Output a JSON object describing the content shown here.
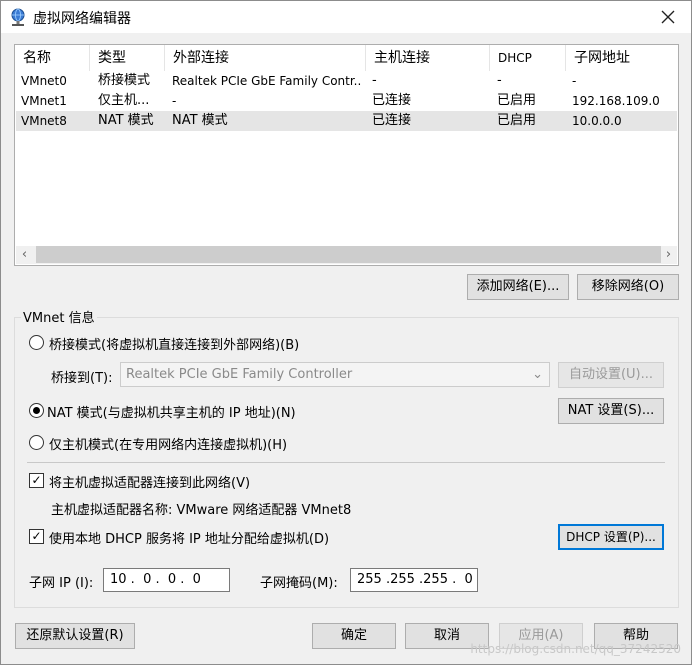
{
  "window": {
    "title": "虚拟网络编辑器"
  },
  "columns": [
    "名称",
    "类型",
    "外部连接",
    "主机连接",
    "DHCP",
    "子网地址"
  ],
  "networks": [
    [
      "VMnet0",
      "桥接模式",
      "Realtek PCIe GbE Family Contr...",
      "-",
      "-",
      "-"
    ],
    [
      "VMnet1",
      "仅主机...",
      "-",
      "已连接",
      "已启用",
      "192.168.109.0"
    ],
    [
      "VMnet8",
      "NAT 模式",
      "NAT 模式",
      "已连接",
      "已启用",
      "10.0.0.0"
    ]
  ],
  "buttons": {
    "add_network": "添加网络(E)...",
    "remove_network": "移除网络(O)",
    "auto_settings": "自动设置(U)...",
    "nat_settings": "NAT 设置(S)...",
    "dhcp_settings": "DHCP 设置(P)...",
    "restore_defaults": "还原默认设置(R)",
    "ok": "确定",
    "cancel": "取消",
    "apply": "应用(A)",
    "help": "帮助"
  },
  "vmnet_info": {
    "group_title": "VMnet 信息",
    "bridge_mode": "桥接模式(将虚拟机直接连接到外部网络)(B)",
    "bridged_to_label": "桥接到(T):",
    "bridged_to_value": "Realtek PCIe GbE Family Controller",
    "nat_mode": "NAT 模式(与虚拟机共享主机的 IP 地址)(N)",
    "host_only_mode": "仅主机模式(在专用网络内连接虚拟机)(H)",
    "connect_adapter": "将主机虚拟适配器连接到此网络(V)",
    "adapter_name": "主机虚拟适配器名称: VMware 网络适配器 VMnet8",
    "use_dhcp": "使用本地 DHCP 服务将 IP 地址分配给虚拟机(D)",
    "subnet_ip_label": "子网 IP (I):",
    "subnet_ip_value": "10 .  0 .  0 .  0",
    "subnet_mask_label": "子网掩码(M):",
    "subnet_mask_value": "255 .255 .255 .  0"
  },
  "watermark": "https://blog.csdn.net/qq_37242520"
}
